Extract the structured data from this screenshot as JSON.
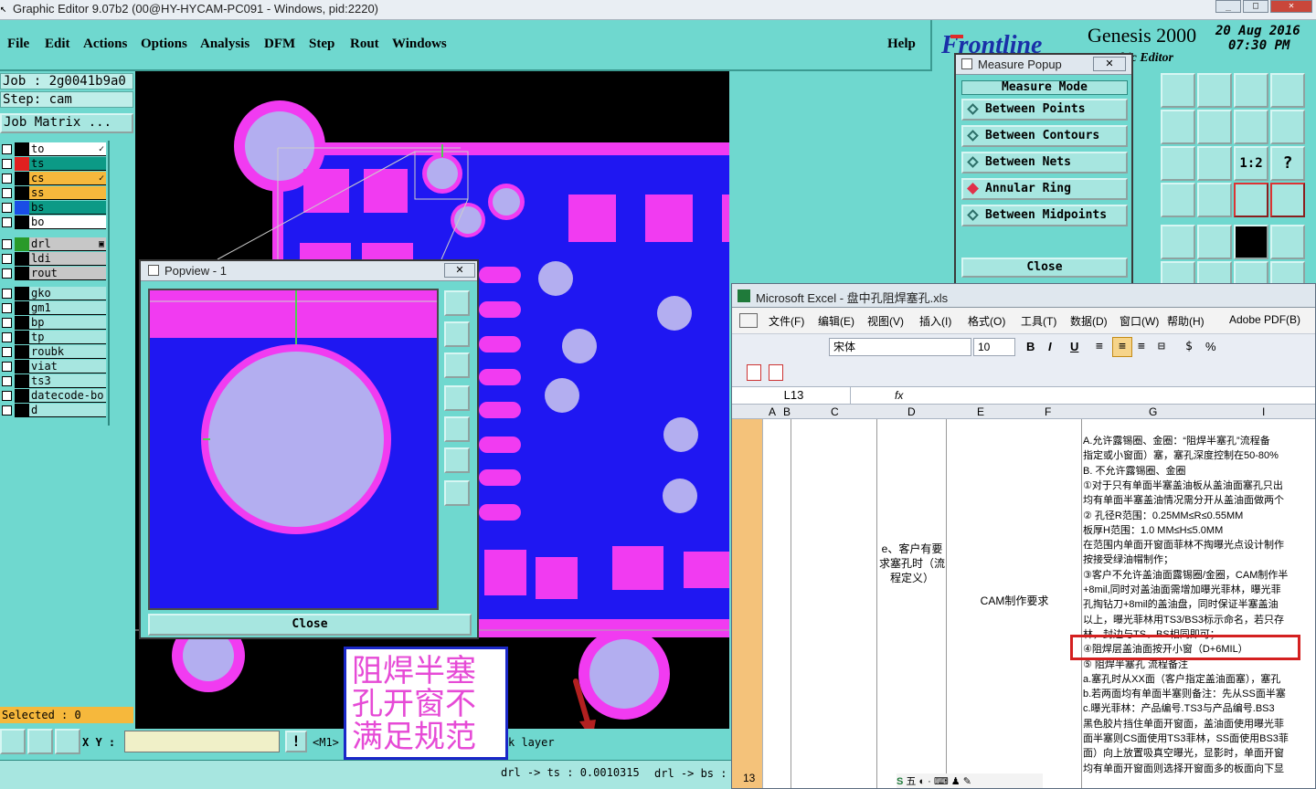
{
  "window": {
    "title": "Graphic Editor 9.07b2 (00@HY-HYCAM-PC091 - Windows, pid:2220)"
  },
  "menu": {
    "items": [
      "File",
      "Edit",
      "Actions",
      "Options",
      "Analysis",
      "DFM",
      "Step",
      "Rout",
      "Windows"
    ],
    "help": "Help"
  },
  "brand": {
    "logo": "Frontline",
    "product": "Genesis 2000",
    "subtitle": "hic Editor",
    "date": "20  Aug  2016",
    "time": "07:30  PM"
  },
  "job": {
    "job_label": "Job : 2g0041b9a0",
    "step_label": "Step: cam",
    "matrix_button": "Job Matrix ..."
  },
  "layers": {
    "group1": [
      {
        "name": "to",
        "color": "#000000",
        "bg": "#ffffff",
        "mark": "✓"
      },
      {
        "name": "ts",
        "color": "#e02020",
        "bg": "#0c9a86",
        "mark": ""
      },
      {
        "name": "cs",
        "color": "#000000",
        "bg": "#f6b83c",
        "mark": "✓"
      },
      {
        "name": "ss",
        "color": "#000000",
        "bg": "#f6b83c",
        "mark": ""
      },
      {
        "name": "bs",
        "color": "#1a4ee6",
        "bg": "#0c9a86",
        "mark": ""
      },
      {
        "name": "bo",
        "color": "#000000",
        "bg": "#ffffff",
        "mark": ""
      }
    ],
    "group2": [
      {
        "name": "drl",
        "color": "#2a9a2a",
        "bg": "#c7c7c7",
        "mark": "▣"
      },
      {
        "name": "ldi",
        "color": "#000000",
        "bg": "#c7c7c7",
        "mark": ""
      },
      {
        "name": "rout",
        "color": "#000000",
        "bg": "#c7c7c7",
        "mark": ""
      }
    ],
    "group3": [
      {
        "name": "gko",
        "color": "#000000",
        "bg": "#a7e6e0",
        "mark": ""
      },
      {
        "name": "gm1",
        "color": "#000000",
        "bg": "#a7e6e0",
        "mark": ""
      },
      {
        "name": "bp",
        "color": "#000000",
        "bg": "#a7e6e0",
        "mark": ""
      },
      {
        "name": "tp",
        "color": "#000000",
        "bg": "#a7e6e0",
        "mark": ""
      },
      {
        "name": "roubk",
        "color": "#000000",
        "bg": "#a7e6e0",
        "mark": ""
      },
      {
        "name": "viat",
        "color": "#000000",
        "bg": "#a7e6e0",
        "mark": ""
      },
      {
        "name": "ts3",
        "color": "#000000",
        "bg": "#a7e6e0",
        "mark": ""
      },
      {
        "name": "datecode-bo",
        "color": "#000000",
        "bg": "#a7e6e0",
        "mark": ""
      },
      {
        "name": "d",
        "color": "#000000",
        "bg": "#a7e6e0",
        "mark": ""
      }
    ],
    "selected": "Selected : 0"
  },
  "popview": {
    "title": "Popview - 1",
    "close": "Close"
  },
  "measure": {
    "title": "Measure Popup",
    "header": "Measure  Mode",
    "modes": [
      {
        "label": "Between Points",
        "active": false
      },
      {
        "label": "Between Contours",
        "active": false
      },
      {
        "label": "Between Nets",
        "active": false
      },
      {
        "label": "Annular Ring",
        "active": true
      },
      {
        "label": "Between Midpoints",
        "active": false
      }
    ],
    "close": "Close"
  },
  "status": {
    "xy_label": "X Y :",
    "xy_value": "",
    "m1": "<M1>",
    "layer_hint": "k layer",
    "measure_result_1": "drl -> ts : 0.0010315",
    "measure_result_2": "drl -> bs :"
  },
  "annotation": {
    "text": "阻焊半塞孔开窗不满足规范"
  },
  "excel": {
    "title": "Microsoft Excel - 盘中孔阻焊塞孔.xls",
    "menu": [
      "文件(F)",
      "编辑(E)",
      "视图(V)",
      "插入(I)",
      "格式(O)",
      "工具(T)",
      "数据(D)",
      "窗口(W)",
      "帮助(H)",
      "Adobe PDF(B)"
    ],
    "font_name": "宋体",
    "font_size": "10",
    "name_box": "L13",
    "fx": "fx",
    "columns": [
      "A",
      "B",
      "C",
      "D",
      "E",
      "F",
      "G",
      "I"
    ],
    "row_number": "13",
    "cell_d": "e、客户有要求塞孔时（流程定义）",
    "cell_e": "CAM制作要求",
    "cell_g_lines": [
      "A.允许露锡圈、金圈：“阻焊半塞孔”流程备",
      "指定或小窗面）塞，塞孔深度控制在50-80%",
      "B. 不允许露锡圈、金圈",
      "①对于只有单面半塞盖油板从盖油面塞孔只出",
      "均有单面半塞盖油情况需分开从盖油面做两个",
      "② 孔径R范围：0.25MM≤R≤0.55MM",
      "   板厚H范围：1.0 MM≤H≤5.0MM",
      "在范围内单面开窗面菲林不掏曝光点设计制作",
      "按接受绿油帽制作；",
      "③客户不允许盖油面露锡圈/金圈，CAM制作半",
      "+8mil,同时对盖油面需增加曝光菲林，曝光菲",
      "孔掏钻刀+8mil的盖油盘，同时保证半塞盖油",
      "以上，曝光菲林用TS3/BS3标示命名，若只存",
      "林，封边与TS、BS相同即可；",
      "④阻焊层盖油面按开小窗（D+6MIL）",
      "⑤ 阻焊半塞孔 流程备注",
      "a.塞孔时从XX面（客户指定盖油面塞），塞孔",
      "b.若两面均有单面半塞则备注：先从SS面半塞",
      "c.曝光菲林：产品编号.TS3与产品编号.BS3",
      "黑色胶片挡住单面开窗面，盖油面使用曝光菲",
      "面半塞则CS面使用TS3菲林，SS面使用BS3菲",
      "面）向上放置吸真空曝光，显影时，单面开窗",
      "均有单面开窗面则选择开窗面多的板面向下显"
    ],
    "highlight_line_index": 14
  }
}
